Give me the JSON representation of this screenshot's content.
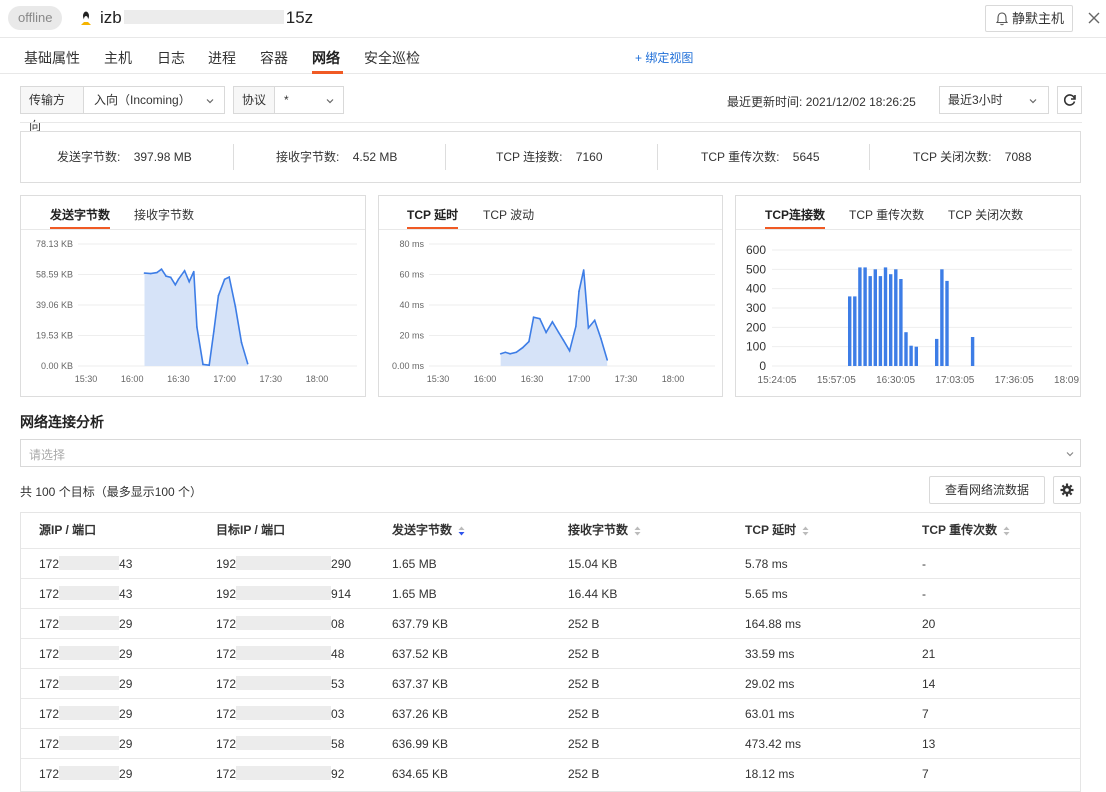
{
  "header": {
    "status_badge": "offline",
    "host_prefix": "izb",
    "host_suffix": "15z",
    "silent_button": "静默主机"
  },
  "tabs": [
    {
      "label": "基础属性",
      "active": false
    },
    {
      "label": "主机",
      "active": false
    },
    {
      "label": "日志",
      "active": false
    },
    {
      "label": "进程",
      "active": false
    },
    {
      "label": "容器",
      "active": false
    },
    {
      "label": "网络",
      "active": true
    },
    {
      "label": "安全巡检",
      "active": false
    }
  ],
  "bind_view": "+ 绑定视图",
  "filters": {
    "direction_label": "传输方向",
    "direction_value": "入向（Incoming）",
    "protocol_label": "协议",
    "protocol_value": "*",
    "update_label": "最近更新时间:",
    "update_time": "2021/12/02 18:26:25",
    "range_value": "最近3小时"
  },
  "stats": [
    {
      "label": "发送字节数:",
      "value": "397.98 MB"
    },
    {
      "label": "接收字节数:",
      "value": "4.52 MB"
    },
    {
      "label": "TCP 连接数:",
      "value": "7160"
    },
    {
      "label": "TCP 重传次数:",
      "value": "5645"
    },
    {
      "label": "TCP 关闭次数:",
      "value": "7088"
    }
  ],
  "panels": [
    {
      "tabs": [
        "发送字节数",
        "接收字节数"
      ],
      "active": 0
    },
    {
      "tabs": [
        "TCP 延时",
        "TCP 波动"
      ],
      "active": 0
    },
    {
      "tabs": [
        "TCP连接数",
        "TCP 重传次数",
        "TCP 关闭次数"
      ],
      "active": 0
    }
  ],
  "chart_data": [
    {
      "type": "area",
      "title": "发送字节数",
      "y_ticks": [
        "78.13 KB",
        "58.59 KB",
        "39.06 KB",
        "19.53 KB",
        "0.00 KB"
      ],
      "ylim": [
        0,
        78.13
      ],
      "y_unit": "KB",
      "x_ticks": [
        "15:30",
        "16:00",
        "16:30",
        "17:00",
        "17:30",
        "18:00"
      ],
      "x": [
        "16:08",
        "16:12",
        "16:16",
        "16:19",
        "16:22",
        "16:25",
        "16:28",
        "16:30",
        "16:34",
        "16:37",
        "16:40",
        "16:42",
        "16:46",
        "16:50",
        "16:53",
        "16:56",
        "17:00",
        "17:03",
        "17:07",
        "17:11",
        "17:15"
      ],
      "values": [
        59.5,
        59.2,
        59.8,
        62.0,
        57.5,
        56.8,
        52.0,
        55.5,
        61.0,
        54.0,
        60.5,
        25.0,
        1.0,
        0.5,
        22.0,
        45.0,
        55.5,
        57.0,
        38.0,
        15.0,
        1.5
      ]
    },
    {
      "type": "area",
      "title": "TCP 延时",
      "y_ticks": [
        "80 ms",
        "60 ms",
        "40 ms",
        "20 ms",
        "0.00 ms"
      ],
      "ylim": [
        0,
        80
      ],
      "y_unit": "ms",
      "x_ticks": [
        "15:30",
        "16:00",
        "16:30",
        "17:00",
        "17:30",
        "18:00"
      ],
      "x": [
        "16:10",
        "16:13",
        "16:16",
        "16:20",
        "16:24",
        "16:28",
        "16:31",
        "16:35",
        "16:39",
        "16:43",
        "16:47",
        "16:50",
        "16:54",
        "16:58",
        "17:00",
        "17:03",
        "17:06",
        "17:10",
        "17:14",
        "17:18"
      ],
      "values": [
        8,
        9,
        8,
        9,
        12,
        16,
        32,
        31,
        22,
        29,
        22,
        17,
        10,
        26,
        49,
        63,
        25,
        30,
        18,
        4
      ]
    },
    {
      "type": "bar",
      "title": "TCP连接数",
      "y_ticks": [
        "600",
        "500",
        "400",
        "300",
        "200",
        "100",
        "0"
      ],
      "ylim": [
        0,
        600
      ],
      "x_ticks": [
        "15:24:05",
        "15:57:05",
        "16:30:05",
        "17:03:05",
        "17:36:05",
        "18:09:06"
      ],
      "values": [
        360,
        360,
        510,
        510,
        465,
        500,
        465,
        510,
        475,
        500,
        450,
        175,
        105,
        100,
        0,
        0,
        0,
        140,
        500,
        440,
        0,
        0,
        0,
        0,
        150
      ]
    }
  ],
  "analysis": {
    "title": "网络连接分析",
    "select_placeholder": "请选择",
    "count_text": "共 100 个目标（最多显示100 个）",
    "flow_button": "查看网络流数据"
  },
  "table": {
    "headers": [
      "源IP / 端口",
      "目标IP / 端口",
      "发送字节数",
      "接收字节数",
      "TCP 延时",
      "TCP 重传次数"
    ],
    "rows": [
      [
        "172",
        "43",
        "192",
        "290",
        "1.65 MB",
        "15.04 KB",
        "5.78 ms",
        "-"
      ],
      [
        "172",
        "43",
        "192",
        "914",
        "1.65 MB",
        "16.44 KB",
        "5.65 ms",
        "-"
      ],
      [
        "172",
        "29",
        "172",
        "08",
        "637.79 KB",
        "252 B",
        "164.88 ms",
        "20"
      ],
      [
        "172",
        "29",
        "172",
        "48",
        "637.52 KB",
        "252 B",
        "33.59 ms",
        "21"
      ],
      [
        "172",
        "29",
        "172",
        "53",
        "637.37 KB",
        "252 B",
        "29.02 ms",
        "14"
      ],
      [
        "172",
        "29",
        "172",
        "03",
        "637.26 KB",
        "252 B",
        "63.01 ms",
        "7"
      ],
      [
        "172",
        "29",
        "172",
        "58",
        "636.99 KB",
        "252 B",
        "473.42 ms",
        "13"
      ],
      [
        "172",
        "29",
        "172",
        "92",
        "634.65 KB",
        "252 B",
        "18.12 ms",
        "7"
      ]
    ]
  },
  "colors": {
    "accent": "#f05a24",
    "link": "#1f6fd8",
    "series": "#3d7de6",
    "area": "#d6e3f8"
  }
}
